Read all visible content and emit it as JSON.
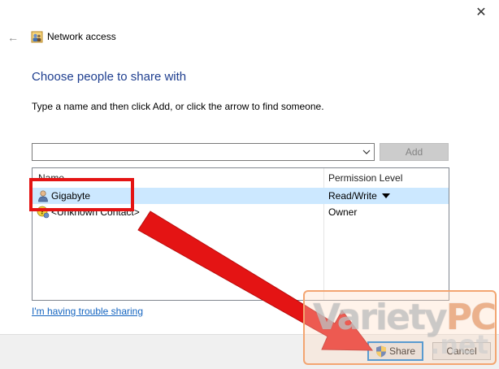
{
  "window": {
    "close_glyph": "✕",
    "back_glyph": "←",
    "nav_title": "Network access"
  },
  "main": {
    "heading": "Choose people to share with",
    "instructions": "Type a name and then click Add, or click the arrow to find someone.",
    "name_input": {
      "value": "",
      "placeholder": ""
    },
    "add_label": "Add",
    "list": {
      "columns": [
        "Name",
        "Permission Level"
      ],
      "rows": [
        {
          "name": "Gigabyte",
          "permission": "Read/Write",
          "selected": true,
          "icon": "user-icon"
        },
        {
          "name": "<Unknown Contact>",
          "permission": "Owner",
          "selected": false,
          "icon": "unknown-contact-icon"
        }
      ]
    },
    "trouble_link": "I'm having trouble sharing"
  },
  "footer": {
    "share_label": "Share",
    "cancel_label": "Cancel"
  },
  "watermark": {
    "text_a": "Variety",
    "text_b": "PC",
    "text_c": ".net"
  },
  "colors": {
    "heading": "#1e3e8f",
    "link": "#1565c0",
    "selection": "#cce8ff",
    "annotation_red": "#e41414",
    "focus_blue": "#0078d7"
  }
}
